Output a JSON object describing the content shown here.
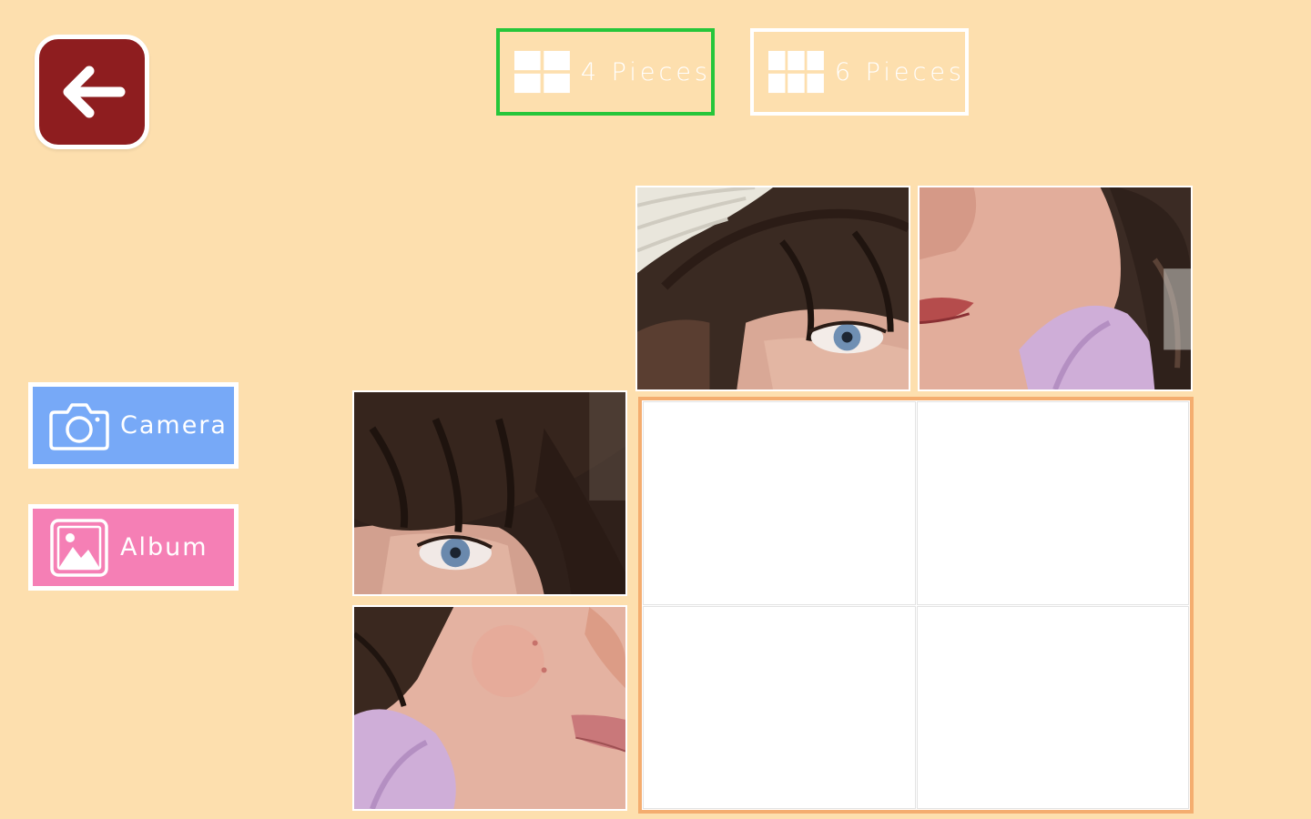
{
  "back_button": {
    "icon": "arrow-left-icon",
    "color": "#8e1d1f"
  },
  "piece_options": [
    {
      "label": "4  Pieces",
      "icon": "grid-4-icon",
      "selected": true,
      "border_color": "#26c63a"
    },
    {
      "label": "6  Pieces",
      "icon": "grid-6-icon",
      "selected": false,
      "border_color": "#ffffff"
    }
  ],
  "sources": {
    "camera": {
      "label": "Camera",
      "icon": "camera-icon",
      "color": "#77a9f7"
    },
    "album": {
      "label": "Album",
      "icon": "image-gallery-icon",
      "color": "#f57fb5"
    }
  },
  "pieces": [
    {
      "name": "photo-piece-hat-eye",
      "image": "child-photo-fragment"
    },
    {
      "name": "photo-piece-mouth-cheek",
      "image": "child-photo-fragment"
    },
    {
      "name": "photo-piece-bangs-eye",
      "image": "child-photo-fragment"
    },
    {
      "name": "photo-piece-cheek",
      "image": "child-photo-fragment"
    }
  ],
  "board": {
    "rows": 2,
    "cols": 2,
    "filled_slots": 0,
    "border_color": "#f4ad6f"
  },
  "colors": {
    "background": "#fddfae",
    "active_outline": "#26c63a"
  }
}
